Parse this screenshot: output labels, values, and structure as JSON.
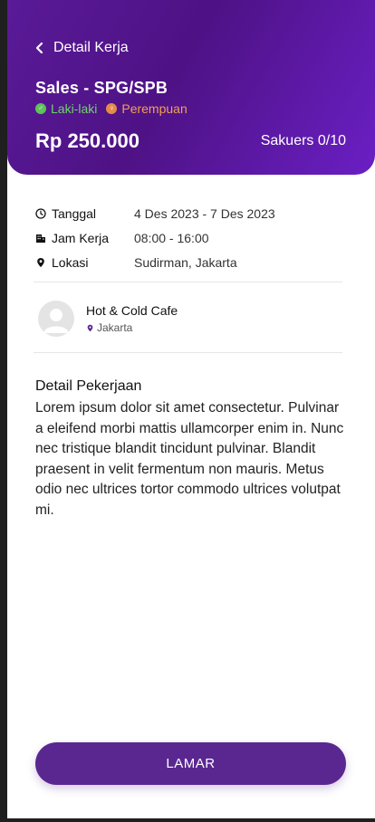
{
  "header": {
    "back_label": "Detail Kerja",
    "job_title": "Sales - SPG/SPB",
    "genders": [
      {
        "label": "Laki-laki",
        "icon": "male-icon",
        "color": "#5ec258"
      },
      {
        "label": "Perempuan",
        "icon": "female-icon",
        "color": "#e58c4a"
      }
    ],
    "price": "Rp 250.000",
    "quota": "Sakuers 0/10"
  },
  "details": {
    "date_label": "Tanggal",
    "date_value": "4 Des 2023 - 7 Des 2023",
    "hours_label": "Jam Kerja",
    "hours_value": "08:00 - 16:00",
    "location_label": "Lokasi",
    "location_value": "Sudirman, Jakarta"
  },
  "company": {
    "name": "Hot & Cold Cafe",
    "city": "Jakarta"
  },
  "description": {
    "title": "Detail Pekerjaan",
    "body": "Lorem ipsum dolor sit amet consectetur. Pulvinar a eleifend morbi mattis ullamcorper enim in. Nunc nec tristique blandit tincidunt pulvinar. Blandit praesent in velit fermentum non mauris. Metus odio nec ultrices tortor commodo ultrices volutpat mi."
  },
  "apply_button": "LAMAR",
  "colors": {
    "header_primary": "#4e1285",
    "header_accent": "#6a1fc4",
    "button": "#5a2790"
  }
}
